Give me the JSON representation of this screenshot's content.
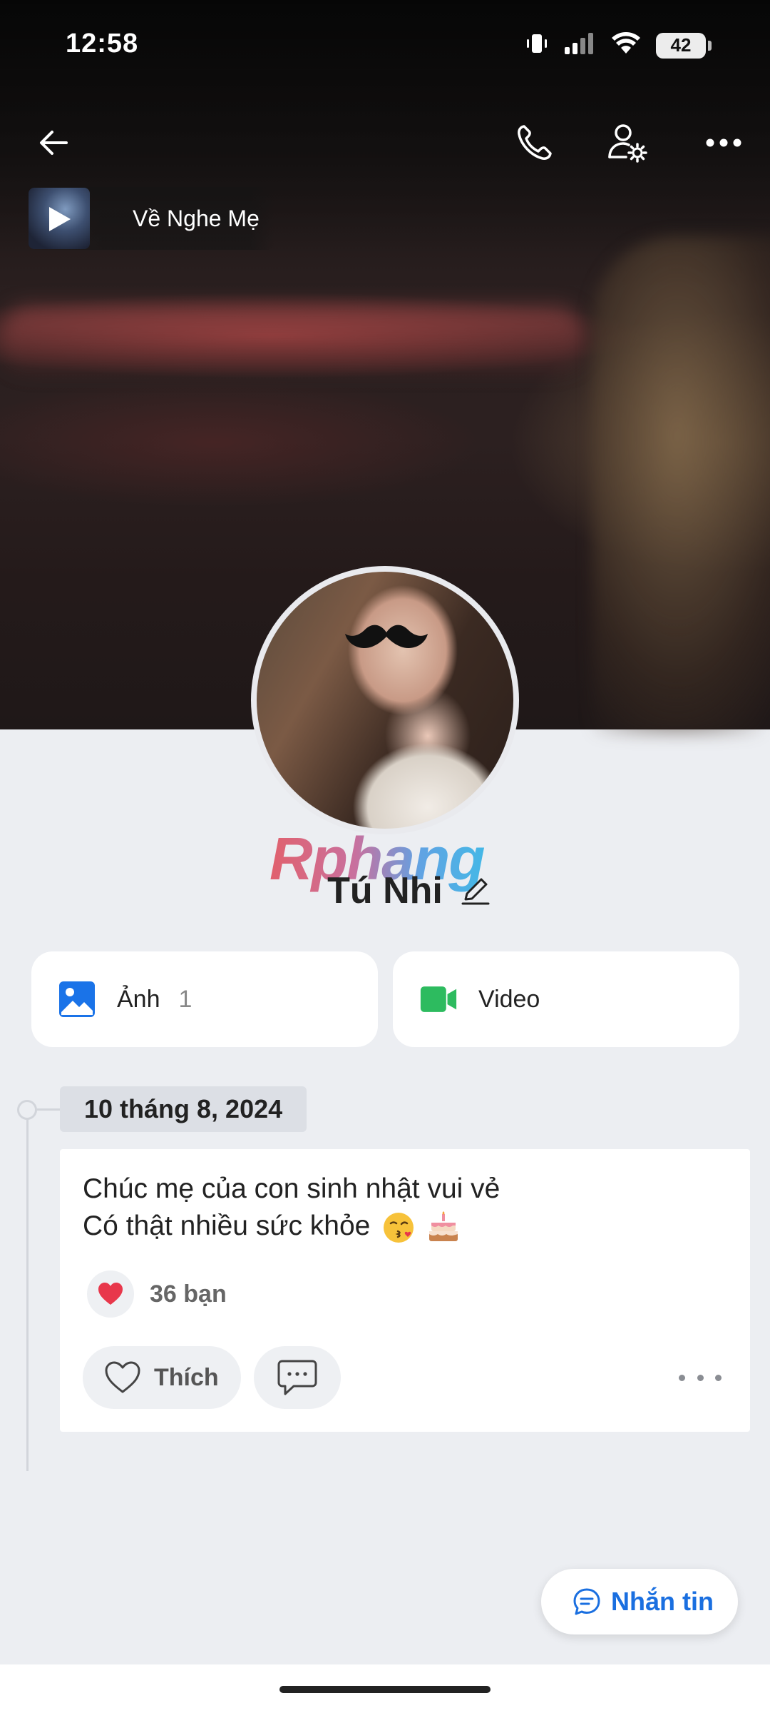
{
  "status_bar": {
    "time": "12:58",
    "battery": "42",
    "icons": [
      "vibrate-icon",
      "cellular-signal-icon",
      "wifi-icon",
      "battery-icon"
    ]
  },
  "nav": {
    "icons": [
      "back-arrow-icon",
      "phone-icon",
      "user-settings-icon",
      "more-icon"
    ]
  },
  "music": {
    "title": "Về Nghe Mẹ"
  },
  "profile": {
    "watermark": "Rphang",
    "name": "Tú Nhi"
  },
  "media": {
    "photos_label": "Ảnh",
    "photos_count": "1",
    "videos_label": "Video"
  },
  "timeline": {
    "date": "10 tháng 8, 2024"
  },
  "post": {
    "line1": "Chúc mẹ của con sinh nhật vui vẻ",
    "line2": "Có thật nhiều sức khỏe",
    "reaction_count": "36 bạn",
    "like_label": "Thích"
  },
  "actions": {
    "message_label": "Nhắn tin"
  },
  "colors": {
    "accent_blue": "#1a6fe0",
    "photo_icon": "#1a73e8",
    "video_icon": "#2dbb5f",
    "heart": "#e8374b"
  }
}
